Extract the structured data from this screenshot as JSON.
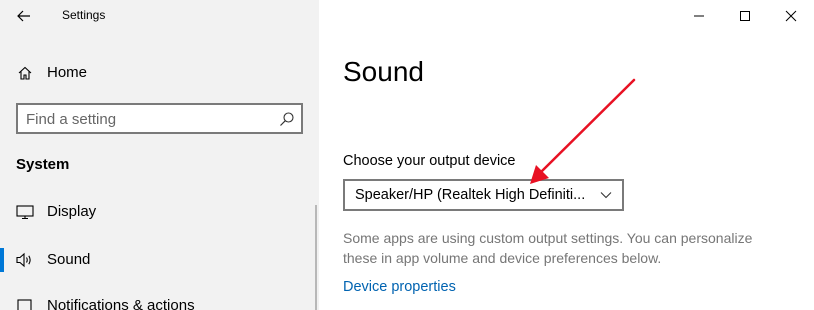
{
  "window": {
    "title": "Settings",
    "back_icon": "back-arrow-icon",
    "controls": [
      "minimize-icon",
      "maximize-icon",
      "close-icon"
    ]
  },
  "sidebar": {
    "home": {
      "label": "Home",
      "icon": "home-icon"
    },
    "search": {
      "placeholder": "Find a setting",
      "icon": "search-icon"
    },
    "section_title": "System",
    "items": [
      {
        "label": "Display",
        "icon": "display-icon",
        "selected": false
      },
      {
        "label": "Sound",
        "icon": "speaker-icon",
        "selected": true
      },
      {
        "label": "Notifications & actions",
        "icon": "notifications-icon",
        "selected": false
      }
    ]
  },
  "main": {
    "page_title": "Sound",
    "output": {
      "label": "Choose your output device",
      "selected_value": "Speaker/HP (Realtek High Definiti..."
    },
    "info_text": "Some apps are using custom output settings. You can personalize these in app volume and device preferences below.",
    "device_properties_link": "Device properties"
  },
  "annotation": {
    "arrow_color": "#e81123"
  },
  "colors": {
    "accent": "#0078d7",
    "link": "#0063b1",
    "sidebar_bg": "#f2f2f2"
  }
}
